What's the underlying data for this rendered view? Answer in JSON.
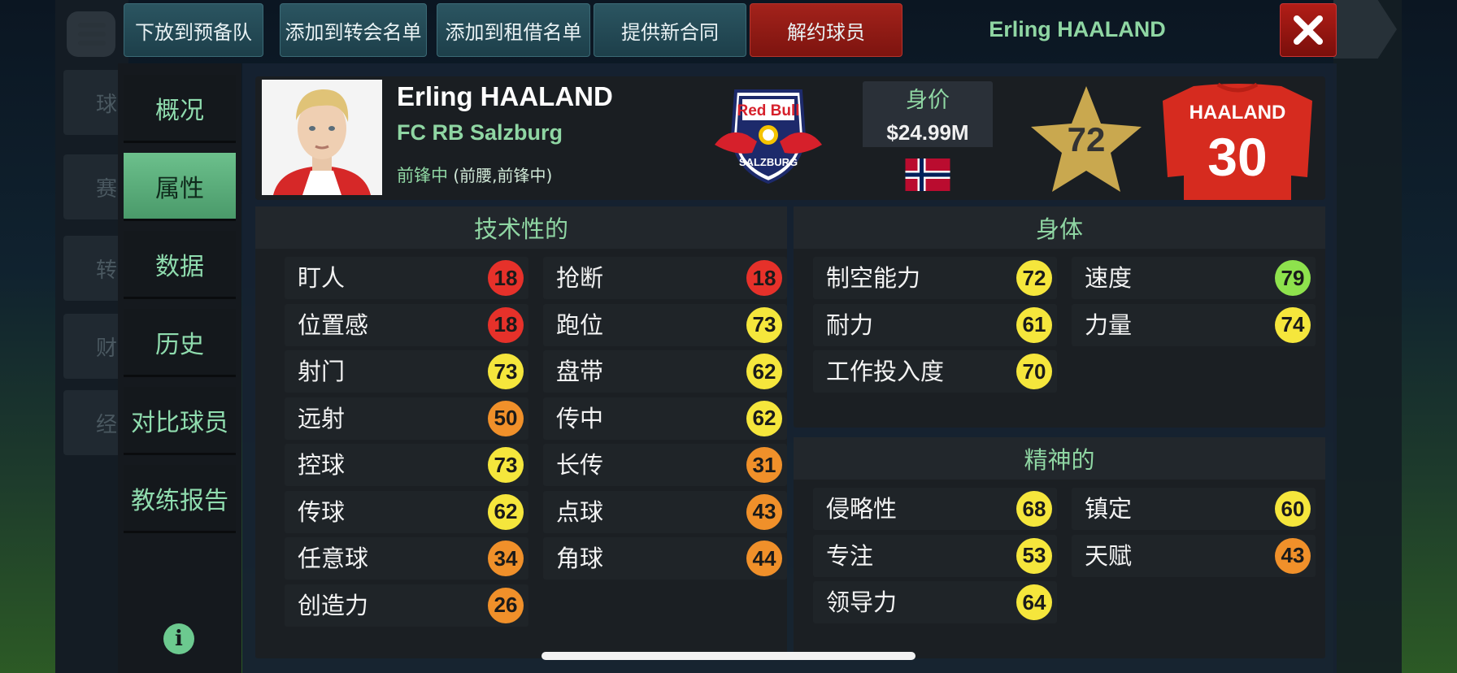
{
  "colors": {
    "accent_green": "#8fd6a3",
    "button_teal": "#2b5561",
    "button_red": "#a3221b",
    "badge_red": "#e6312a",
    "badge_orange": "#f0902a",
    "badge_yellow": "#f5e63c",
    "badge_green": "#8ee24d"
  },
  "ghost_tabs": [
    "球",
    "赛",
    "转",
    "财",
    "经"
  ],
  "toolbar": {
    "buttons": [
      "下放到预备队",
      "添加到转会名单",
      "添加到租借名单",
      "提供新合同",
      "解约球员"
    ],
    "title": "Erling HAALAND",
    "close_icon": "close-icon"
  },
  "sidebar": {
    "items": [
      "概况",
      "属性",
      "数据",
      "历史",
      "对比球员",
      "教练报告"
    ],
    "active": "属性",
    "info_symbol": "i"
  },
  "player": {
    "name": "Erling HAALAND",
    "club": "FC RB Salzburg",
    "position_main": "前锋中",
    "position_alt": "(前腰,前锋中)",
    "value_label": "身价",
    "value": "$24.99M",
    "nationality_flag": "norway-flag",
    "overall_rating": "72",
    "shirt_name": "HAALAND",
    "shirt_number": "30"
  },
  "club_logo": {
    "text_top": "Red Bull",
    "text_bottom": "SALZBURG"
  },
  "technical": {
    "title": "技术性的",
    "left": [
      {
        "label": "盯人",
        "value": "18",
        "tier": "red"
      },
      {
        "label": "位置感",
        "value": "18",
        "tier": "red"
      },
      {
        "label": "射门",
        "value": "73",
        "tier": "yellow"
      },
      {
        "label": "远射",
        "value": "50",
        "tier": "orange"
      },
      {
        "label": "控球",
        "value": "73",
        "tier": "yellow"
      },
      {
        "label": "传球",
        "value": "62",
        "tier": "yellow"
      },
      {
        "label": "任意球",
        "value": "34",
        "tier": "orange"
      },
      {
        "label": "创造力",
        "value": "26",
        "tier": "orange"
      }
    ],
    "right": [
      {
        "label": "抢断",
        "value": "18",
        "tier": "red"
      },
      {
        "label": "跑位",
        "value": "73",
        "tier": "yellow"
      },
      {
        "label": "盘带",
        "value": "62",
        "tier": "yellow"
      },
      {
        "label": "传中",
        "value": "62",
        "tier": "yellow"
      },
      {
        "label": "长传",
        "value": "31",
        "tier": "orange"
      },
      {
        "label": "点球",
        "value": "43",
        "tier": "orange"
      },
      {
        "label": "角球",
        "value": "44",
        "tier": "orange"
      }
    ]
  },
  "physical": {
    "title": "身体",
    "left": [
      {
        "label": "制空能力",
        "value": "72",
        "tier": "yellow"
      },
      {
        "label": "耐力",
        "value": "61",
        "tier": "yellow"
      },
      {
        "label": "工作投入度",
        "value": "70",
        "tier": "yellow"
      }
    ],
    "right": [
      {
        "label": "速度",
        "value": "79",
        "tier": "green"
      },
      {
        "label": "力量",
        "value": "74",
        "tier": "yellow"
      }
    ]
  },
  "mental": {
    "title": "精神的",
    "left": [
      {
        "label": "侵略性",
        "value": "68",
        "tier": "yellow"
      },
      {
        "label": "专注",
        "value": "53",
        "tier": "yellow"
      },
      {
        "label": "领导力",
        "value": "64",
        "tier": "yellow"
      }
    ],
    "right": [
      {
        "label": "镇定",
        "value": "60",
        "tier": "yellow"
      },
      {
        "label": "天赋",
        "value": "43",
        "tier": "orange"
      }
    ]
  }
}
